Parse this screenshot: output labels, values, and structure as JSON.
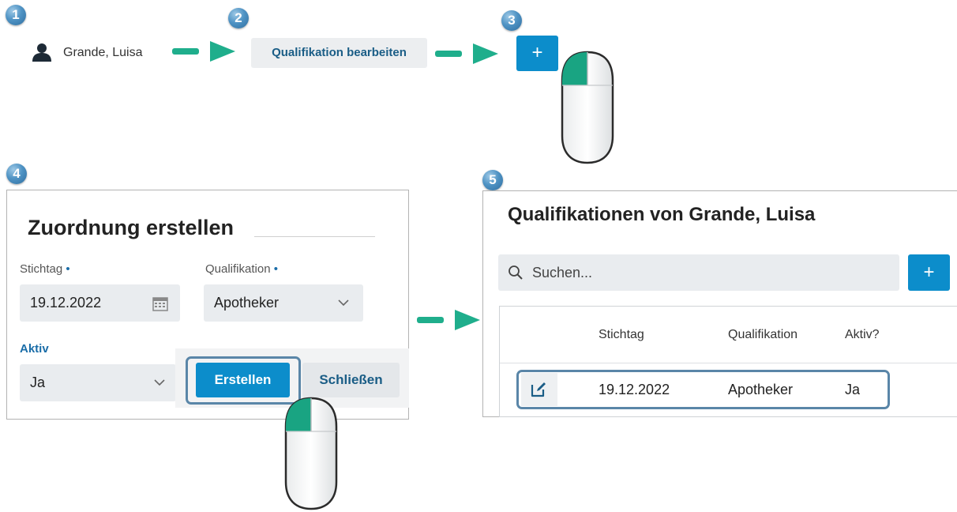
{
  "steps": {
    "s1": "1",
    "s2": "2",
    "s3": "3",
    "s4": "4",
    "s5": "5"
  },
  "user": {
    "name": "Grande, Luisa",
    "icon": "person-icon"
  },
  "qualification_button": {
    "label": "Qualifikation bearbeiten"
  },
  "add_button": {
    "label": "+"
  },
  "dialog": {
    "title": "Zuordnung erstellen",
    "stichtag_label": "Stichtag",
    "required_marker": "•",
    "stichtag_value": "19.12.2022",
    "qualifikation_label": "Qualifikation",
    "qualifikation_value": "Apotheker",
    "aktiv_label": "Aktiv",
    "aktiv_value": "Ja",
    "create_label": "Erstellen",
    "close_label": "Schließen"
  },
  "panel": {
    "title": "Qualifikationen von Grande, Luisa",
    "search_placeholder": "Suchen...",
    "add_label": "+",
    "columns": [
      "Stichtag",
      "Qualifikation",
      "Aktiv?"
    ],
    "rows": [
      {
        "stichtag": "19.12.2022",
        "qualifikation": "Apotheker",
        "aktiv": "Ja"
      }
    ]
  },
  "colors": {
    "accent": "#0c8dcb",
    "arrow_green": "#1fae8c",
    "highlight": "#5a86a8"
  }
}
